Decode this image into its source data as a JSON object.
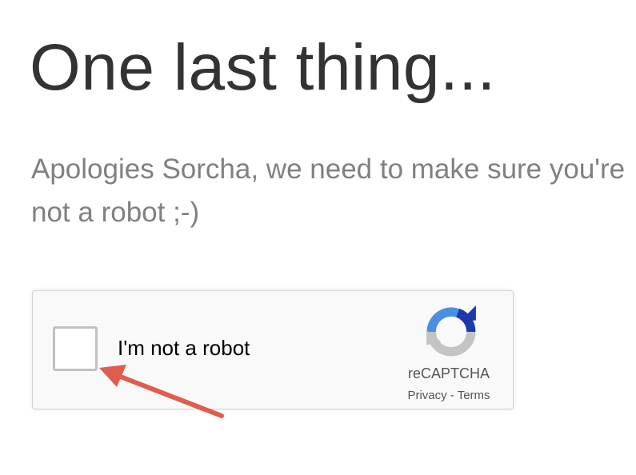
{
  "page": {
    "title": "One last thing...",
    "subtitle": "Apologies Sorcha, we need to make sure you're not a robot ;-)"
  },
  "recaptcha": {
    "checkbox_label": "I'm not a robot",
    "checked": false,
    "brand": "reCAPTCHA",
    "privacy_label": "Privacy",
    "separator": " - ",
    "terms_label": "Terms",
    "logo_icon": "recaptcha-logo-icon"
  },
  "annotation": {
    "arrow_icon": "arrow-icon",
    "arrow_color": "#e05d4e"
  },
  "colors": {
    "title": "#333333",
    "subtitle": "#808080",
    "widget_background": "#f9f9f9",
    "widget_border": "#d3d3d3",
    "logo_blue": "#1c3aa9",
    "logo_light_blue": "#4a90e2",
    "logo_gray": "#c4c4c4"
  }
}
